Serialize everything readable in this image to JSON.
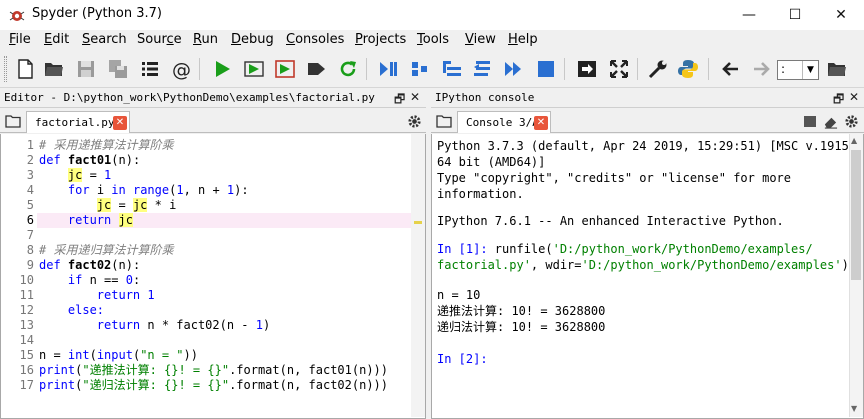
{
  "window": {
    "title": "Spyder (Python 3.7)",
    "minimize": "—",
    "maximize": "☐",
    "close": "✕"
  },
  "menu": [
    {
      "label": "File",
      "mn": "F",
      "rest": "ile"
    },
    {
      "label": "Edit",
      "mn": "E",
      "rest": "dit"
    },
    {
      "label": "Search",
      "mn": "S",
      "rest": "earch"
    },
    {
      "label": "Source",
      "mn": "",
      "pre": "Sour",
      "mid": "c",
      "post": "e"
    },
    {
      "label": "Run",
      "mn": "R",
      "rest": "un"
    },
    {
      "label": "Debug",
      "mn": "D",
      "rest": "ebug"
    },
    {
      "label": "Consoles",
      "mn": "C",
      "rest": "onsoles"
    },
    {
      "label": "Projects",
      "mn": "P",
      "rest": "rojects"
    },
    {
      "label": "Tools",
      "mn": "T",
      "rest": "ools"
    },
    {
      "label": "View",
      "mn": "V",
      "rest": "iew"
    },
    {
      "label": "Help",
      "mn": "H",
      "rest": "elp"
    }
  ],
  "toolbar": {
    "icons": [
      "new-file-icon",
      "open-folder-icon",
      "save-icon",
      "save-all-icon",
      "list-icon",
      "at-icon",
      "run-icon",
      "run-cell-icon",
      "run-cell-advance-icon",
      "run-selection-icon",
      "rerun-icon",
      "debug-icon",
      "step-icon",
      "step-into-icon",
      "step-return-icon",
      "continue-icon",
      "stop-icon",
      "maximize-pane-icon",
      "fullscreen-icon",
      "wrench-icon",
      "python-icon",
      "back-icon",
      "forward-icon"
    ],
    "combo_value": ":"
  },
  "editor": {
    "header": "Editor - D:\\python_work\\PythonDemo\\examples\\factorial.py",
    "tab_label": "factorial.py",
    "current_line": 6,
    "line_numbers": [
      "1",
      "2",
      "3",
      "4",
      "5",
      "6",
      "7",
      "8",
      "9",
      "10",
      "11",
      "12",
      "13",
      "14",
      "15",
      "16",
      "17"
    ]
  },
  "console": {
    "header": "IPython console",
    "tab_label": "Console 3/A",
    "lines": {
      "l1": "Python 3.7.3 (default, Apr 24 2019, 15:29:51) [MSC v.1915",
      "l2": "64 bit (AMD64)]",
      "l3": "Type \"copyright\", \"credits\" or \"license\" for more",
      "l4": "information.",
      "l5": "IPython 7.6.1 -- An enhanced Interactive Python.",
      "p1": "In [1]:",
      "l6a": " runfile(",
      "l6b": "'D:/python_work/PythonDemo/examples/",
      "l7a": "factorial.py'",
      "l7b": ", wdir=",
      "l7c": "'D:/python_work/PythonDemo/examples'",
      "l7d": ")",
      "l8": "n = 10",
      "l9": "递推法计算: 10! = 3628800",
      "l10": "递归法计算: 10! = 3628800",
      "p2": "In [2]:"
    }
  },
  "code": {
    "c1": "# 采用递推算法计算阶乘",
    "kw_def": "def",
    "f1": "fact01",
    "f1_sig": "(n):",
    "jc": "jc",
    "eq1": " = ",
    "one": "1",
    "kw_for": "for",
    "for_i": " i ",
    "kw_in": "in",
    "range": "range",
    "range_args_a": "(",
    "range_args_b": ", n + ",
    "range_args_c": "):",
    "eq_mul": " * i",
    "kw_return": "return",
    "c2": "# 采用递归算法计算阶乘",
    "f2": "fact02",
    "kw_if": "if",
    "if_cond": " n == ",
    "zero": "0",
    "colon": ":",
    "kw_else": "else:",
    "ret_expr": " n * fact02(n - ",
    "ret_close": ")",
    "n_assign": "n = ",
    "int": "int",
    "input": "input",
    "input_str": "\"n = \"",
    "paren_open": "(",
    "paren_close2": "))",
    "print": "print",
    "fmt1": "\"递推法计算: {}! = {}\"",
    "fmt2": "\"递归法计算: {}! = {}\"",
    "fmt_call1": ".format(n, fact01(n)))",
    "fmt_call2": ".format(n, fact02(n)))"
  }
}
